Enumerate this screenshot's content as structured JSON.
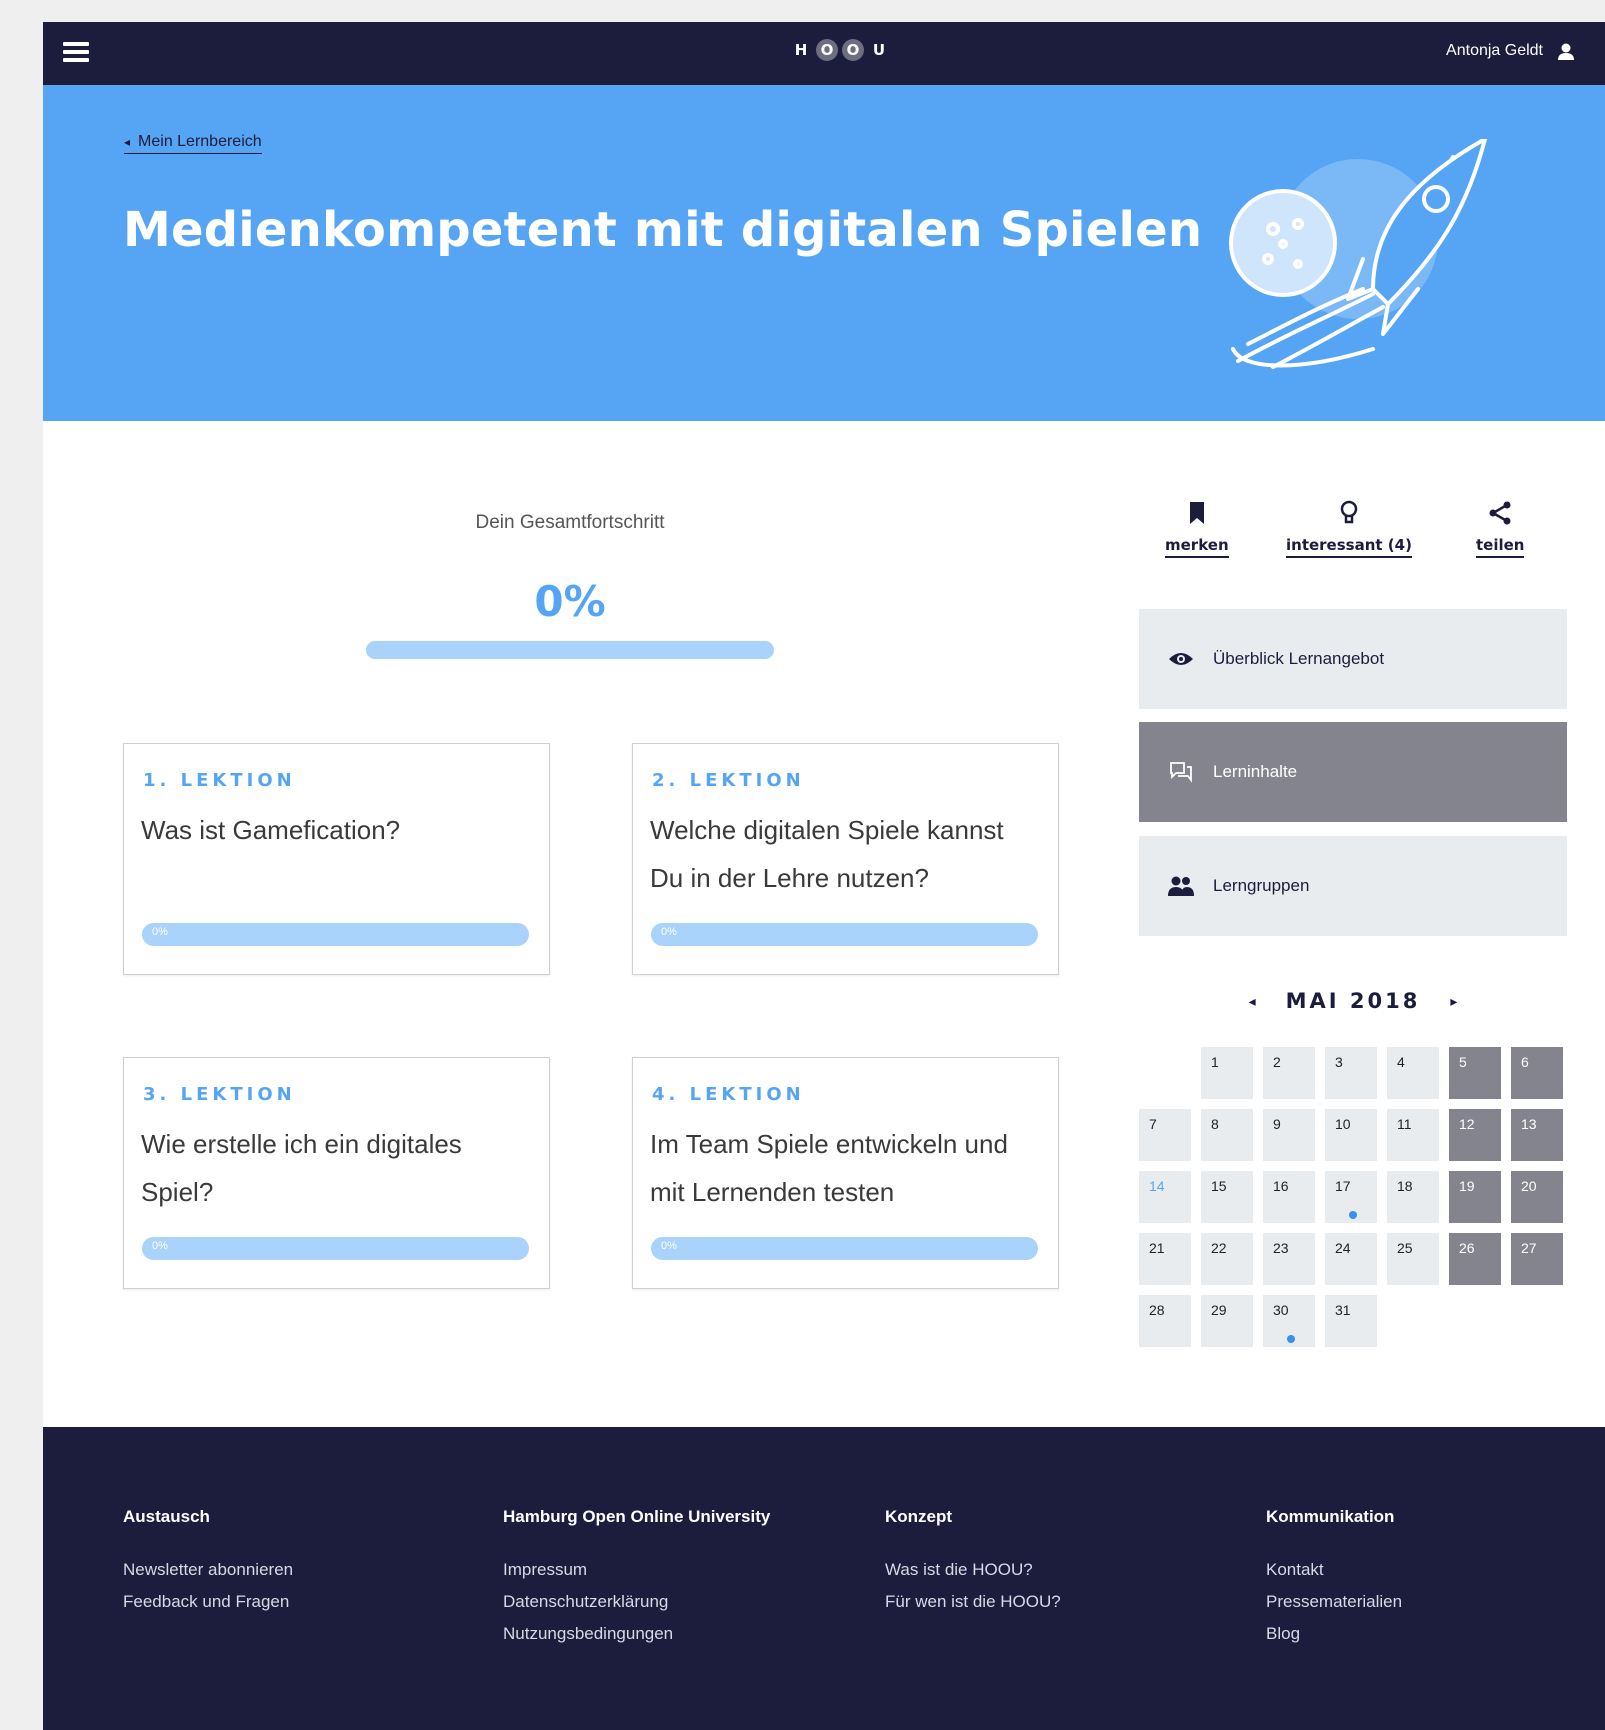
{
  "header": {
    "logo": [
      "H",
      "O",
      "O",
      "U"
    ],
    "user_name": "Antonja Geldt"
  },
  "hero": {
    "breadcrumb": "Mein Lernbereich",
    "title": "Medienkompetent mit digitalen Spielen",
    "background": "#56a5f5"
  },
  "progress": {
    "label": "Dein Gesamtfortschritt",
    "value_text": "0%",
    "value": 0
  },
  "lessons": [
    {
      "kicker": "1. LEKTION",
      "title": "Was ist Gamefication?",
      "progress": 0,
      "progress_text": "0%"
    },
    {
      "kicker": "2. LEKTION",
      "title": "Welche digitalen Spiele kannst Du in der Lehre nutzen?",
      "progress": 0,
      "progress_text": "0%"
    },
    {
      "kicker": "3. LEKTION",
      "title": "Wie erstelle ich ein digitales Spiel?",
      "progress": 0,
      "progress_text": "0%"
    },
    {
      "kicker": "4. LEKTION",
      "title": "Im Team Spiele entwickeln und mit Lernenden testen",
      "progress": 0,
      "progress_text": "0%"
    }
  ],
  "actions": {
    "bookmark": {
      "label": "merken",
      "icon": "bookmark-icon"
    },
    "interesting": {
      "label": "interessant (4)",
      "icon": "lightbulb-icon"
    },
    "share": {
      "label": "teilen",
      "icon": "share-icon"
    }
  },
  "side_nav": [
    {
      "label": "Überblick Lernangebot",
      "icon": "eye-icon",
      "active": false
    },
    {
      "label": "Lerninhalte",
      "icon": "chat-icon",
      "active": true
    },
    {
      "label": "Lerngruppen",
      "icon": "group-icon",
      "active": false
    }
  ],
  "calendar": {
    "month": "MAI 2018",
    "prev_icon": "◂",
    "next_icon": "▸",
    "days": [
      "1",
      "2",
      "3",
      "4",
      "5",
      "6",
      "7",
      "8",
      "9",
      "10",
      "11",
      "12",
      "13",
      "14",
      "15",
      "16",
      "17",
      "18",
      "19",
      "20",
      "21",
      "22",
      "23",
      "24",
      "25",
      "26",
      "27",
      "28",
      "29",
      "30",
      "31"
    ],
    "first_weekday_offset": 1,
    "weekend_days": [
      5,
      6,
      12,
      13,
      19,
      20,
      26,
      27
    ],
    "today": 14,
    "event_days": [
      17,
      30
    ]
  },
  "footer": {
    "columns": [
      {
        "heading": "Austausch",
        "links": [
          "Newsletter abonnieren",
          "Feedback und Fragen"
        ]
      },
      {
        "heading": "Hamburg Open Online University",
        "links": [
          "Impressum",
          "Datenschutzerklärung",
          "Nutzungsbedingungen"
        ]
      },
      {
        "heading": "Konzept",
        "links": [
          "Was ist die HOOU?",
          "Für wen ist die HOOU?"
        ]
      },
      {
        "heading": "Kommunikation",
        "links": [
          "Kontakt",
          "Pressematerialien",
          "Blog"
        ]
      }
    ]
  },
  "colors": {
    "navy": "#1c1c3c",
    "accent": "#56a5f5",
    "bar_light": "#a9d3fa",
    "active_nav": "#84848f",
    "nav_bg": "#e9ecef"
  }
}
